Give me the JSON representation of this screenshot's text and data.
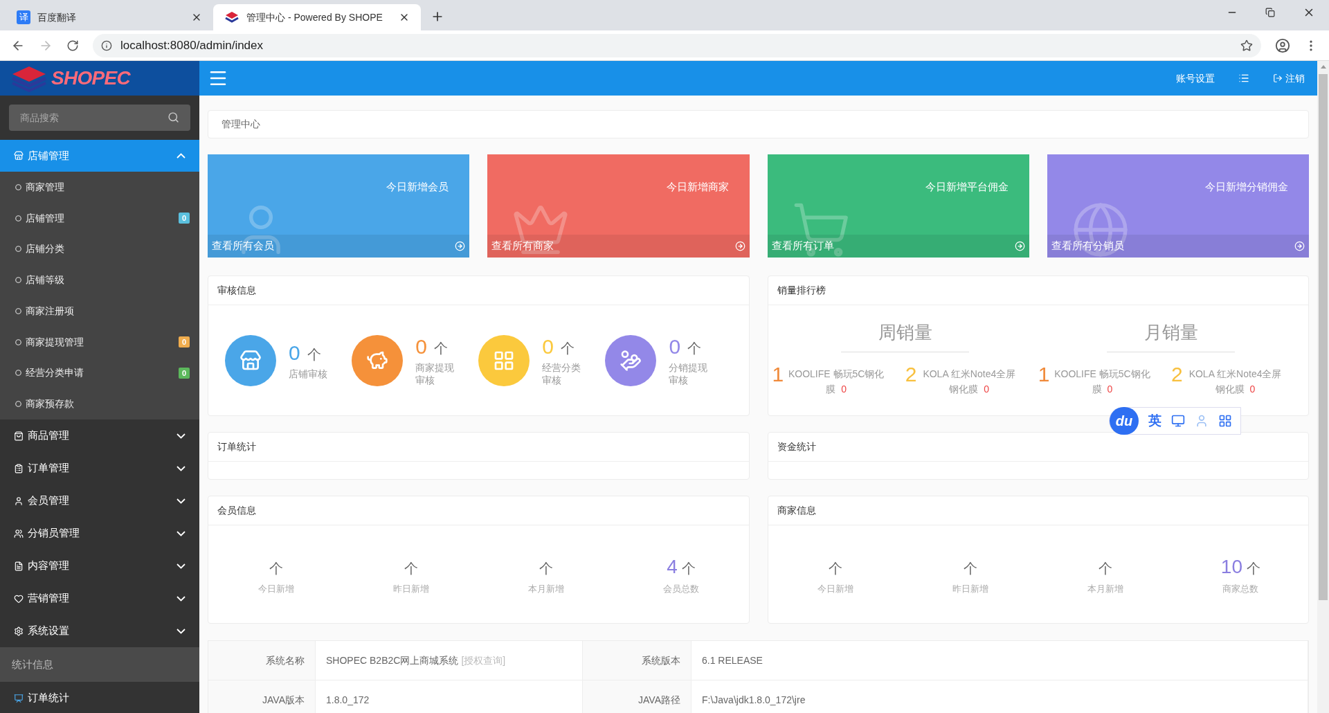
{
  "browser": {
    "tabs": [
      {
        "icon_text": "译",
        "title": "百度翻译",
        "selected": false
      },
      {
        "title": "管理中心 - Powered By SHOPE",
        "selected": true
      }
    ],
    "url": "localhost:8080/admin/index"
  },
  "header": {
    "logo": "SHOPEC",
    "account": "账号设置",
    "logout": "注销"
  },
  "sidebar": {
    "search_placeholder": "商品搜索",
    "groups": [
      {
        "label": "店铺管理",
        "selected": true,
        "expanded": true,
        "children": [
          {
            "label": "商家管理"
          },
          {
            "label": "店铺管理",
            "badge": "0",
            "color": "#5bc0de"
          },
          {
            "label": "店铺分类"
          },
          {
            "label": "店铺等级"
          },
          {
            "label": "商家注册项"
          },
          {
            "label": "商家提现管理",
            "badge": "0",
            "color": "#f0ad4e"
          },
          {
            "label": "经营分类申请",
            "badge": "0",
            "color": "#5cb85c"
          },
          {
            "label": "商家预存款"
          }
        ]
      },
      {
        "label": "商品管理",
        "selected": false,
        "expanded": false
      },
      {
        "label": "订单管理",
        "selected": false,
        "expanded": false
      },
      {
        "label": "会员管理",
        "selected": false,
        "expanded": false
      },
      {
        "label": "分销员管理",
        "selected": false,
        "expanded": false
      },
      {
        "label": "内容管理",
        "selected": false,
        "expanded": false
      },
      {
        "label": "营销管理",
        "selected": false,
        "expanded": false
      },
      {
        "label": "系统设置",
        "selected": false,
        "expanded": false
      }
    ],
    "section": "统计信息",
    "section_items": [
      {
        "label": "订单统计"
      }
    ]
  },
  "breadcrumb": "管理中心",
  "cards": [
    {
      "title": "今日新增会员",
      "link": "查看所有会员",
      "color": "#4aa6e8"
    },
    {
      "title": "今日新增商家",
      "link": "查看所有商家",
      "color": "#f06b62"
    },
    {
      "title": "今日新增平台佣金",
      "link": "查看所有订单",
      "color": "#3bbb7d"
    },
    {
      "title": "今日新增分销佣金",
      "link": "查看所有分销员",
      "color": "#9388e8"
    }
  ],
  "audit": {
    "title": "审核信息",
    "items": [
      {
        "value": "0",
        "unit": "个",
        "label": "店铺审核",
        "color": "#4aa6e8"
      },
      {
        "value": "0",
        "unit": "个",
        "label": "商家提现审核",
        "color": "#f5913a"
      },
      {
        "value": "0",
        "unit": "个",
        "label": "经营分类审核",
        "color": "#fbc93d"
      },
      {
        "value": "0",
        "unit": "个",
        "label": "分销提现审核",
        "color": "#9388e8"
      }
    ]
  },
  "ranking": {
    "title": "销量排行榜",
    "columns": [
      {
        "heading": "周销量",
        "items": [
          {
            "rank": "1",
            "name": "KOOLIFE 畅玩5C钢化膜",
            "count": "0",
            "color": "#f08a3a"
          },
          {
            "rank": "2",
            "name": "KOLA 红米Note4全屏钢化膜",
            "count": "0",
            "color": "#f8c03e"
          }
        ]
      },
      {
        "heading": "月销量",
        "items": [
          {
            "rank": "1",
            "name": "KOOLIFE 畅玩5C钢化膜",
            "count": "0",
            "color": "#f08a3a"
          },
          {
            "rank": "2",
            "name": "KOLA 红米Note4全屏钢化膜",
            "count": "0",
            "color": "#f8c03e"
          }
        ]
      }
    ]
  },
  "order_stats": {
    "title": "订单统计"
  },
  "fund_stats": {
    "title": "资金统计"
  },
  "member_info": {
    "title": "会员信息",
    "items": [
      {
        "unit": "个",
        "label": "今日新增"
      },
      {
        "unit": "个",
        "label": "昨日新增"
      },
      {
        "unit": "个",
        "label": "本月新增"
      },
      {
        "value": "4",
        "unit": "个",
        "label": "会员总数"
      }
    ]
  },
  "merchant_info": {
    "title": "商家信息",
    "items": [
      {
        "unit": "个",
        "label": "今日新增"
      },
      {
        "unit": "个",
        "label": "昨日新增"
      },
      {
        "unit": "个",
        "label": "本月新增"
      },
      {
        "value": "10",
        "unit": "个",
        "label": "商家总数"
      }
    ]
  },
  "system_table": {
    "rows": [
      {
        "cells": [
          {
            "label": "系统名称",
            "value": "SHOPEC B2B2C网上商城系统",
            "link": "[授权查询]"
          },
          {
            "label": "系统版本",
            "value": "6.1 RELEASE"
          }
        ]
      },
      {
        "cells": [
          {
            "label": "JAVA版本",
            "value": "1.8.0_172"
          },
          {
            "label": "JAVA路径",
            "value": "F:\\Java\\jdk1.8.0_172\\jre"
          }
        ]
      }
    ]
  },
  "translate_toolbar": {
    "logo": "du",
    "language": "英"
  }
}
